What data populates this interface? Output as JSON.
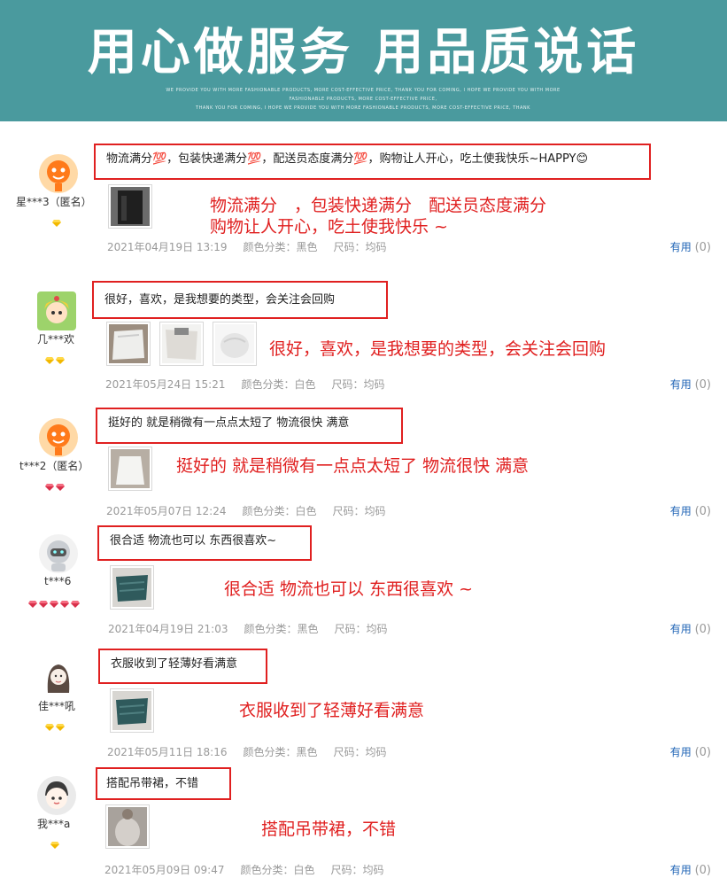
{
  "banner": {
    "title": "用心做服务 用品质说话",
    "sub1": "WE PROVIDE YOU WITH MORE FASHIONABLE PRODUCTS, MORE COST-EFFECTIVE PRICE, THANK YOU FOR COMING, I HOPE WE PROVIDE YOU WITH MORE",
    "sub2": "FASHIONABLE PRODUCTS, MORE COST-EFFECTIVE PRICE,",
    "sub3": "THANK YOU FOR COMING, I HOPE WE PROVIDE YOU WITH MORE FASHIONABLE PRODUCTS, MORE COST-EFFECTIVE PRICE, THANK"
  },
  "labels": {
    "color_prefix": "颜色分类：",
    "size_prefix": "尺码：",
    "useful": "有用"
  },
  "colors": {
    "accent_red": "#e02020",
    "banner_teal": "#4a9a9e",
    "link_blue": "#1e63b5"
  },
  "reviews": [
    {
      "user": "星***3（匿名）",
      "avatar_icon": "orange-mascot-avatar",
      "badge": "gold-diamond",
      "badge_count": 1,
      "comment": "物流满分💯，包装快递满分💯，配送员态度满分💯，购物让人开心，吃土使我快乐~HAPPY😊",
      "annotation_line1": "物流满分　，包装快递满分　配送员态度满分",
      "annotation_line2": "购物让人开心，吃土使我快乐 ~",
      "date": "2021年04月19日 13:19",
      "color": "黑色",
      "size": "均码",
      "useful_count": "(0)",
      "images": 1
    },
    {
      "user": "几***欢",
      "avatar_icon": "anime-girl-avatar",
      "badge": "gold-diamond",
      "badge_count": 2,
      "comment": "很好，喜欢，是我想要的类型，会关注会回购",
      "annotation_line1": "很好，喜欢，是我想要的类型，会关注会回购",
      "date": "2021年05月24日 15:21",
      "color": "白色",
      "size": "均码",
      "useful_count": "(0)",
      "images": 3
    },
    {
      "user": "t***2（匿名）",
      "avatar_icon": "orange-mascot-avatar",
      "badge": "red-heart",
      "badge_count": 2,
      "comment": "挺好的 就是稍微有一点点太短了 物流很快 满意",
      "annotation_line1": "挺好的 就是稍微有一点点太短了 物流很快 满意",
      "date": "2021年05月07日 12:24",
      "color": "白色",
      "size": "均码",
      "useful_count": "(0)",
      "images": 1
    },
    {
      "user": "t***6",
      "avatar_icon": "gray-robot-avatar",
      "badge": "red-heart",
      "badge_count": 5,
      "comment": "很合适 物流也可以 东西很喜欢~",
      "annotation_line1": "很合适 物流也可以 东西很喜欢 ~",
      "date": "2021年04月19日 21:03",
      "color": "黑色",
      "size": "均码",
      "useful_count": "(0)",
      "images": 1
    },
    {
      "user": "佳***吼",
      "avatar_icon": "sketch-girl-avatar",
      "badge": "gold-diamond",
      "badge_count": 2,
      "comment": "衣服收到了轻薄好看满意",
      "annotation_line1": "衣服收到了轻薄好看满意",
      "date": "2021年05月11日 18:16",
      "color": "黑色",
      "size": "均码",
      "useful_count": "(0)",
      "images": 1
    },
    {
      "user": "我***a",
      "avatar_icon": "cartoon-face-avatar",
      "badge": "gold-diamond",
      "badge_count": 1,
      "comment": "搭配吊带裙，不错",
      "annotation_line1": "搭配吊带裙，不错",
      "date": "2021年05月09日 09:47",
      "color": "白色",
      "size": "均码",
      "useful_count": "(0)",
      "images": 1
    }
  ]
}
